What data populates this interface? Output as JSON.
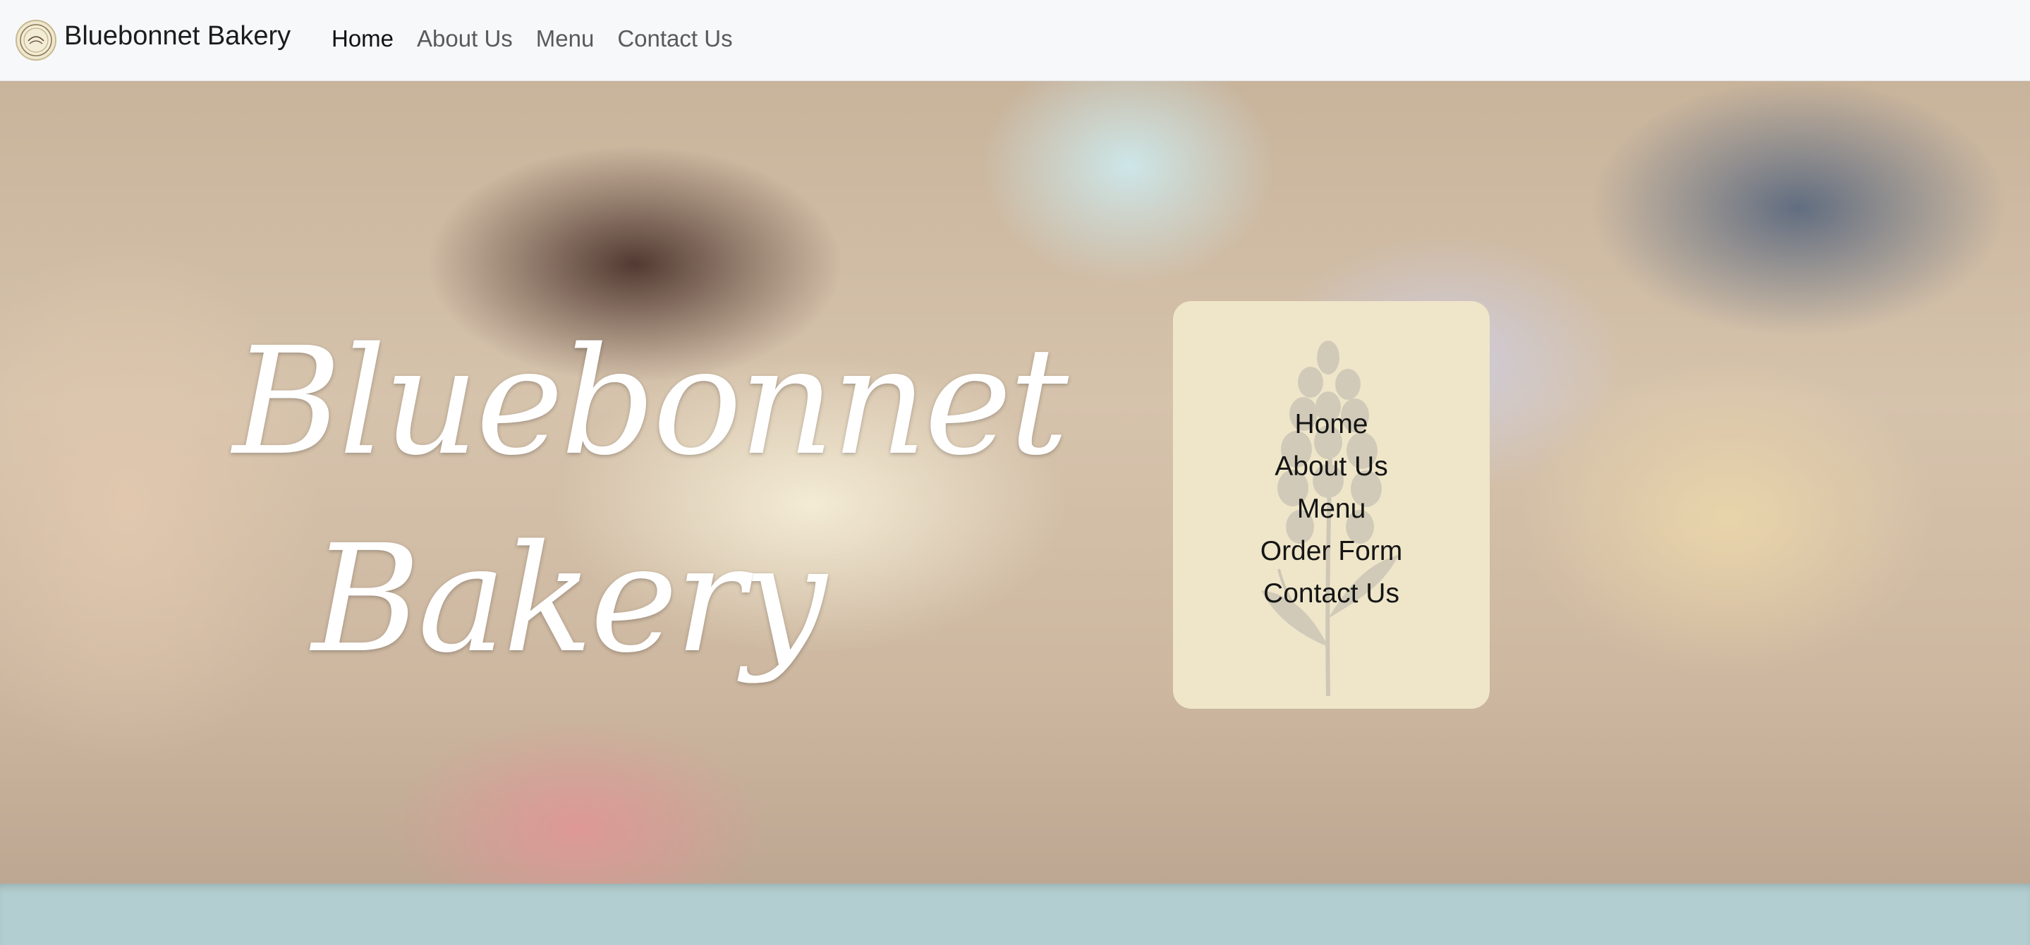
{
  "navbar": {
    "brand": "Bluebonnet Bakery",
    "logo_icon": "bakery-logo-icon",
    "links": [
      "Home",
      "About Us",
      "Menu",
      "Contact Us"
    ],
    "active": "Home"
  },
  "hero": {
    "title_line1": "Bluebonnet",
    "title_line2": "Bakery",
    "menu_items": [
      "Home",
      "About Us",
      "Menu",
      "Order Form",
      "Contact Us"
    ],
    "menu_background_icon": "bluebonnet-flower-icon"
  },
  "colors": {
    "navbar_bg": "#f7f8fa",
    "menu_card_bg": "#efe6ca",
    "footer_band": "#b3ced0",
    "hero_title": "#ffffff"
  }
}
